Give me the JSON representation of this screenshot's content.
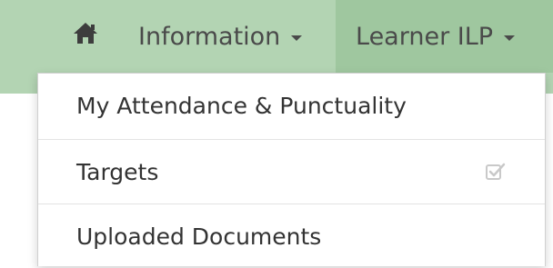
{
  "navbar": {
    "home_icon": "home-icon",
    "information_label": "Information",
    "learner_ilp_label": "Learner ILP"
  },
  "dropdown": {
    "items": [
      {
        "label": "My Attendance & Punctuality"
      },
      {
        "label": "Targets",
        "icon": "checked-box-icon"
      },
      {
        "label": "Uploaded Documents"
      }
    ]
  },
  "colors": {
    "navbar_bg": "#b3d4b3",
    "active_tab_bg": "#9fc79f",
    "text": "#4a4a4a",
    "menu_text": "#333333"
  }
}
